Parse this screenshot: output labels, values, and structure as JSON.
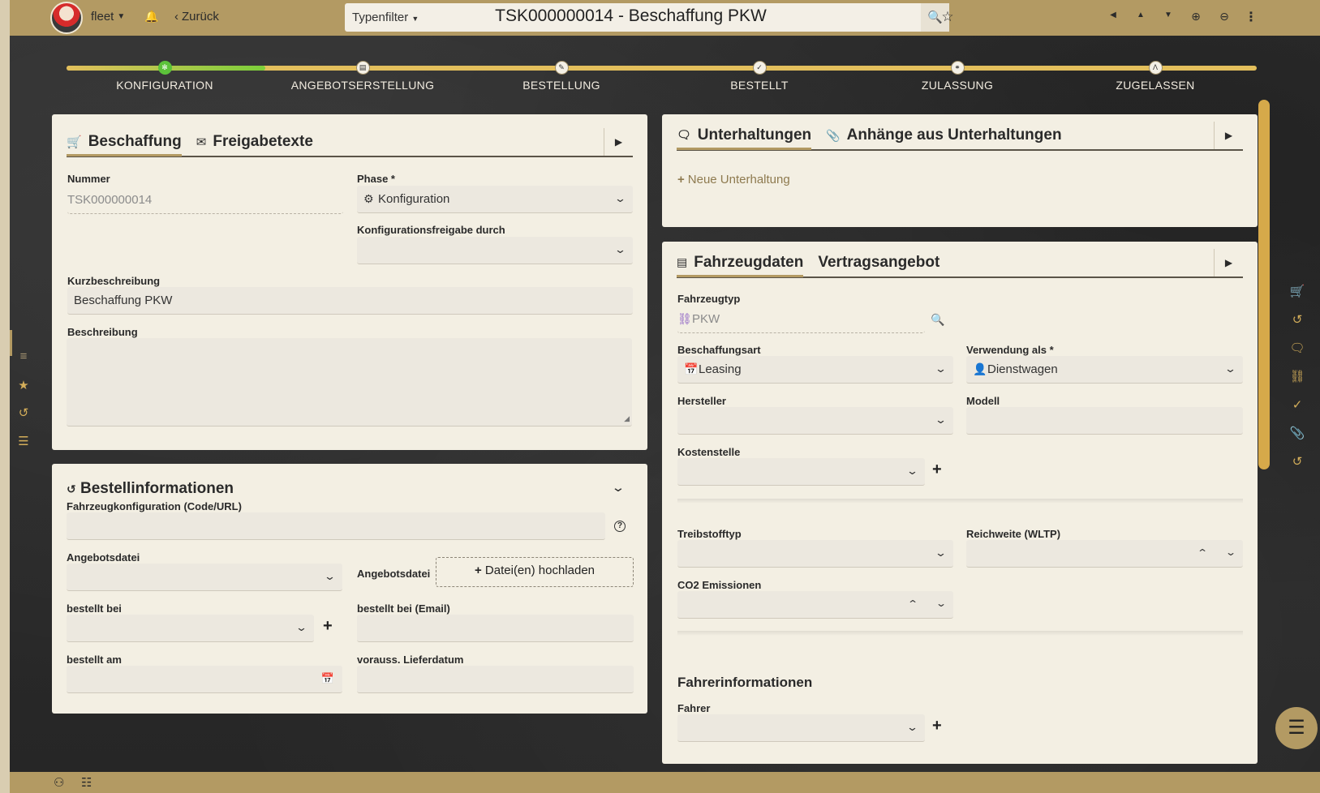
{
  "topbar": {
    "user_label": "fleet",
    "back_label": "Zurück",
    "typefilter_label": "Typenfilter",
    "record_title": "TSK000000014 - Beschaffung PKW"
  },
  "stepper": {
    "steps": [
      {
        "label": "KONFIGURATION",
        "icon": "gears-icon",
        "active": true
      },
      {
        "label": "ANGEBOTSERSTELLUNG",
        "icon": "document-icon"
      },
      {
        "label": "BESTELLUNG",
        "icon": "order-form-icon"
      },
      {
        "label": "BESTELLT",
        "icon": "check-icon"
      },
      {
        "label": "ZULASSUNG",
        "icon": "registration-icon"
      },
      {
        "label": "ZUGELASSEN",
        "icon": "road-icon"
      }
    ]
  },
  "beschaffung_panel": {
    "tabs": [
      "Beschaffung",
      "Freigabetexte"
    ],
    "nummer_label": "Nummer",
    "nummer_value": "TSK000000014",
    "phase_label": "Phase *",
    "phase_value": "Konfiguration",
    "konfigfreigabe_label": "Konfigurationsfreigabe durch",
    "konfigfreigabe_value": "",
    "kurzbeschreibung_label": "Kurzbeschreibung",
    "kurzbeschreibung_value": "Beschaffung PKW",
    "beschreibung_label": "Beschreibung",
    "beschreibung_value": ""
  },
  "bestell_panel": {
    "title": "Bestellinformationen",
    "fahrzeugkonfig_label": "Fahrzeugkonfiguration (Code/URL)",
    "angebotsdatei_label": "Angebotsdatei",
    "angebotsdatei_upload_label": "Angebotsdatei",
    "upload_button_label": "Datei(en) hochladen",
    "bestellt_bei_label": "bestellt bei",
    "bestellt_bei_email_label": "bestellt bei (Email)",
    "bestellt_am_label": "bestellt am",
    "lieferdatum_label": "vorauss. Lieferdatum"
  },
  "unterhaltungen_panel": {
    "tabs": [
      "Unterhaltungen",
      "Anhänge aus Unterhaltungen"
    ],
    "new_label": "Neue Unterhaltung"
  },
  "fahrzeug_panel": {
    "tabs": [
      "Fahrzeugdaten",
      "Vertragsangebot"
    ],
    "fahrzeugtyp_label": "Fahrzeugtyp",
    "fahrzeugtyp_value": "PKW",
    "beschaffungsart_label": "Beschaffungsart",
    "beschaffungsart_value": "Leasing",
    "verwendung_label": "Verwendung als *",
    "verwendung_value": "Dienstwagen",
    "hersteller_label": "Hersteller",
    "modell_label": "Modell",
    "kostenstelle_label": "Kostenstelle",
    "treibstoff_label": "Treibstofftyp",
    "reichweite_label": "Reichweite (WLTP)",
    "co2_label": "CO2 Emissionen",
    "fahrer_section": "Fahrerinformationen",
    "fahrer_label": "Fahrer"
  },
  "colors": {
    "accent": "#b39a63",
    "panel": "#f3efe3",
    "active_step": "#5cc23a",
    "track": "#e3bf5c",
    "vehicle_icon": "#8a5cc4"
  }
}
